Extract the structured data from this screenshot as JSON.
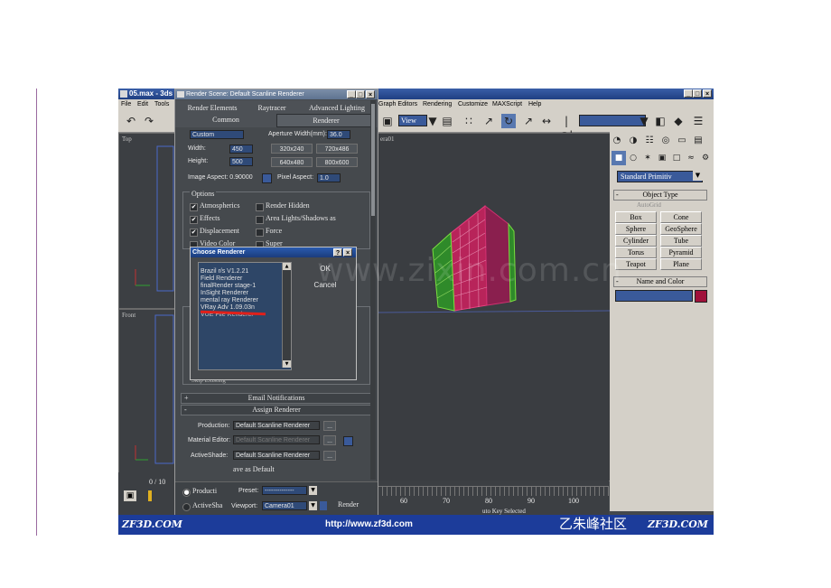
{
  "max_window": {
    "title": "05.max - 3ds",
    "menu": [
      "File",
      "Edit",
      "Tools",
      "Graph Editors",
      "Rendering",
      "Customize",
      "MAXScript",
      "Help"
    ],
    "window_controls": [
      "_",
      "□",
      "×"
    ],
    "toolbar": {
      "view_dropdown": "View"
    }
  },
  "viewports": {
    "top_label": "Top",
    "front_label": "Front",
    "camera_label": "era01"
  },
  "timeline": {
    "frame_counter": "0 / 10",
    "ticks": [
      "60",
      "70",
      "80",
      "90",
      "100"
    ],
    "status_text": "uto Key Selected"
  },
  "command_panel": {
    "category_dropdown": "Standard Primitiv",
    "object_type_header": "Object Type",
    "autogrid_label": "AutoGrid",
    "object_buttons": [
      "Box",
      "Cone",
      "Sphere",
      "GeoSphere",
      "Cylinder",
      "Tube",
      "Torus",
      "Pyramid",
      "Teapot",
      "Plane"
    ],
    "name_color_header": "Name and Color",
    "color_swatch": "#a0113a"
  },
  "render_scene": {
    "title": "Render Scene: Default Scanline Renderer",
    "window_controls": [
      "_",
      "□",
      "×"
    ],
    "tabs": [
      "Render Elements",
      "Raytracer",
      "Advanced Lighting",
      "Common",
      "Renderer"
    ],
    "output_size": {
      "preset": "Custom",
      "aperture_label": "Aperture Width(mm):",
      "aperture_value": "36.0",
      "width_label": "Width:",
      "width_value": "450",
      "height_label": "Height:",
      "height_value": "500",
      "preset_buttons": [
        "320x240",
        "720x486",
        "640x480",
        "800x600"
      ],
      "image_aspect": "Image Aspect: 0.90000",
      "pixel_aspect_label": "Pixel Aspect:",
      "pixel_aspect_value": "1.0"
    },
    "options": {
      "header": "Options",
      "items": [
        {
          "label": "Atmospherics",
          "checked": true
        },
        {
          "label": "Render Hidden",
          "checked": false
        },
        {
          "label": "Effects",
          "checked": true
        },
        {
          "label": "Area Lights/Shadows as",
          "checked": false
        },
        {
          "label": "Displacement",
          "checked": true
        },
        {
          "label": "Force",
          "checked": false
        },
        {
          "label": "Video Color",
          "checked": false
        },
        {
          "label": "Super",
          "checked": false
        }
      ]
    },
    "skip_existing": "Skip Existing",
    "email_header": "Email Notifications",
    "assign_header": "Assign Renderer",
    "assign_rows": [
      {
        "label": "Production:",
        "value": "Default Scanline Renderer"
      },
      {
        "label": "Material Editor:",
        "value": "Default Scanline Renderer"
      },
      {
        "label": "ActiveShade:",
        "value": "Default Scanline Renderer"
      }
    ],
    "dots_button": "...",
    "save_default": "ave as Default",
    "bottom": {
      "production": "Producti",
      "activeshade": "ActiveSha",
      "preset_label": "Preset:",
      "preset_value": "--------------",
      "viewport_label": "Viewport:",
      "viewport_value": "Camera01",
      "render_button": "Render"
    }
  },
  "choose_renderer": {
    "title": "Choose Renderer",
    "title_buttons": [
      "?",
      "×"
    ],
    "renderers": [
      "Brazil r/s V1.2.21",
      "Field Renderer",
      "finalRender stage-1",
      "InSight Renderer",
      "mental ray Renderer",
      "VRay Adv 1.09.03n",
      "VUE File Renderer"
    ],
    "highlighted": "VRay Adv 1.09.03n",
    "ok": "OK",
    "cancel": "Cancel"
  },
  "watermark": "www.zixin.com.cn",
  "footer": {
    "left_brand": "ZF3D.COM",
    "url": "http://www.zf3d.com",
    "cn_brand": "乙朱峰社区",
    "right_brand": "ZF3D.COM"
  }
}
